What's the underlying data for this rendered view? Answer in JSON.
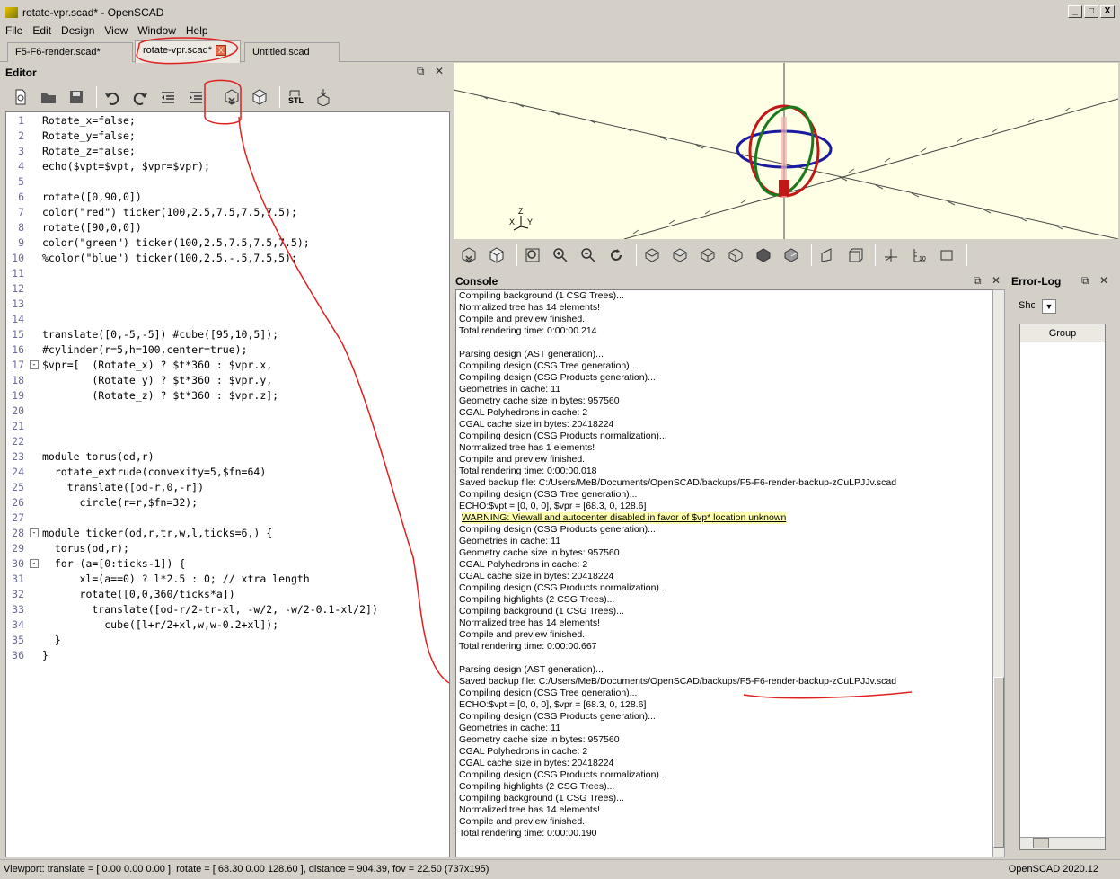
{
  "window": {
    "title": "rotate-vpr.scad* - OpenSCAD",
    "btn_min": "_",
    "btn_max": "□",
    "btn_close": "X"
  },
  "menu": [
    "File",
    "Edit",
    "Design",
    "View",
    "Window",
    "Help"
  ],
  "tabs": [
    {
      "label": "F5-F6-render.scad*",
      "active": false
    },
    {
      "label": "rotate-vpr.scad*",
      "active": true,
      "close": "X"
    },
    {
      "label": "Untitled.scad",
      "active": false
    }
  ],
  "editor": {
    "title": "Editor",
    "toolbar_icons": [
      "new-file-icon",
      "open-file-icon",
      "save-icon",
      "undo-icon",
      "redo-icon",
      "unindent-icon",
      "indent-icon",
      "preview-icon",
      "render-icon",
      "export-stl-icon",
      "send-to-3dprint-icon"
    ],
    "lines": [
      "Rotate_x=false;",
      "Rotate_y=false;",
      "Rotate_z=false;",
      "echo($vpt=$vpt, $vpr=$vpr);",
      "",
      "rotate([0,90,0])",
      "color(\"red\") ticker(100,2.5,7.5,7.5,7.5);",
      "rotate([90,0,0])",
      "color(\"green\") ticker(100,2.5,7.5,7.5,7.5);",
      "%color(\"blue\") ticker(100,2.5,-.5,7.5,5);",
      "",
      "",
      "",
      "",
      "translate([0,-5,-5]) #cube([95,10,5]);",
      "#cylinder(r=5,h=100,center=true);",
      "$vpr=[  (Rotate_x) ? $t*360 : $vpr.x,",
      "        (Rotate_y) ? $t*360 : $vpr.y,",
      "        (Rotate_z) ? $t*360 : $vpr.z];",
      "",
      "",
      "",
      "module torus(od,r)",
      "  rotate_extrude(convexity=5,$fn=64)",
      "    translate([od-r,0,-r])",
      "      circle(r=r,$fn=32);",
      "",
      "module ticker(od,r,tr,w,l,ticks=6,) {",
      "  torus(od,r);",
      "  for (a=[0:ticks-1]) {",
      "      xl=(a==0) ? l*2.5 : 0; // xtra length",
      "      rotate([0,0,360/ticks*a])",
      "        translate([od-r/2-tr-xl, -w/2, -w/2-0.1-xl/2])",
      "          cube([l+r/2+xl,w,w-0.2+xl]);",
      "  }",
      "}"
    ]
  },
  "viewport": {
    "axis_label_z": "Z",
    "axis_label_x": "X",
    "axis_label_y": "Y"
  },
  "view_toolbar_icons": [
    "preview-icon",
    "render-icon",
    "view-all-icon",
    "zoom-in-icon",
    "zoom-out-icon",
    "reset-view-icon",
    "view-right-icon",
    "view-top-icon",
    "view-bottom-icon",
    "view-left-icon",
    "view-front-icon",
    "view-back-icon",
    "perspective-icon",
    "orthogonal-icon",
    "show-axes-icon",
    "show-scales-icon",
    "show-edges-icon"
  ],
  "console": {
    "title": "Console",
    "lines": [
      {
        "t": "Compiling background (1 CSG Trees)..."
      },
      {
        "t": "Normalized tree has 14 elements!"
      },
      {
        "t": "Compile and preview finished."
      },
      {
        "t": "Total rendering time: 0:00:00.214"
      },
      {
        "t": ""
      },
      {
        "t": "Parsing design (AST generation)..."
      },
      {
        "t": "Compiling design (CSG Tree generation)..."
      },
      {
        "t": "Compiling design (CSG Products generation)..."
      },
      {
        "t": "Geometries in cache: 11"
      },
      {
        "t": "Geometry cache size in bytes: 957560"
      },
      {
        "t": "CGAL Polyhedrons in cache: 2"
      },
      {
        "t": "CGAL cache size in bytes: 20418224"
      },
      {
        "t": "Compiling design (CSG Products normalization)..."
      },
      {
        "t": "Normalized tree has 1 elements!"
      },
      {
        "t": "Compile and preview finished."
      },
      {
        "t": "Total rendering time: 0:00:00.018"
      },
      {
        "t": "Saved backup file: C:/Users/MeB/Documents/OpenSCAD/backups/F5-F6-render-backup-zCuLPJJv.scad"
      },
      {
        "t": "Compiling design (CSG Tree generation)..."
      },
      {
        "t": "ECHO:$vpt = [0, 0, 0], $vpr = [68.3, 0, 128.6]"
      },
      {
        "t": "WARNING: Viewall and autocenter disabled in favor of $vp* location unknown",
        "warn": true
      },
      {
        "t": "Compiling design (CSG Products generation)..."
      },
      {
        "t": "Geometries in cache: 11"
      },
      {
        "t": "Geometry cache size in bytes: 957560"
      },
      {
        "t": "CGAL Polyhedrons in cache: 2"
      },
      {
        "t": "CGAL cache size in bytes: 20418224"
      },
      {
        "t": "Compiling design (CSG Products normalization)..."
      },
      {
        "t": "Compiling highlights (2 CSG Trees)..."
      },
      {
        "t": "Compiling background (1 CSG Trees)..."
      },
      {
        "t": "Normalized tree has 14 elements!"
      },
      {
        "t": "Compile and preview finished."
      },
      {
        "t": "Total rendering time: 0:00:00.667"
      },
      {
        "t": ""
      },
      {
        "t": "Parsing design (AST generation)..."
      },
      {
        "t": "Saved backup file: C:/Users/MeB/Documents/OpenSCAD/backups/F5-F6-render-backup-zCuLPJJv.scad"
      },
      {
        "t": "Compiling design (CSG Tree generation)..."
      },
      {
        "t": "ECHO:$vpt = [0, 0, 0], $vpr = [68.3, 0, 128.6]"
      },
      {
        "t": "Compiling design (CSG Products generation)..."
      },
      {
        "t": "Geometries in cache: 11"
      },
      {
        "t": "Geometry cache size in bytes: 957560"
      },
      {
        "t": "CGAL Polyhedrons in cache: 2"
      },
      {
        "t": "CGAL cache size in bytes: 20418224"
      },
      {
        "t": "Compiling design (CSG Products normalization)..."
      },
      {
        "t": "Compiling highlights (2 CSG Trees)..."
      },
      {
        "t": "Compiling background (1 CSG Trees)..."
      },
      {
        "t": "Normalized tree has 14 elements!"
      },
      {
        "t": "Compile and preview finished."
      },
      {
        "t": "Total rendering time: 0:00:00.190"
      }
    ]
  },
  "errorlog": {
    "title": "Error-Log",
    "show_label": "Show",
    "column": "Group"
  },
  "status": {
    "viewport": "Viewport: translate = [ 0.00 0.00 0.00 ], rotate = [ 68.30 0.00 128.60 ], distance = 904.39, fov = 22.50 (737x195)",
    "version": "OpenSCAD 2020.12"
  }
}
